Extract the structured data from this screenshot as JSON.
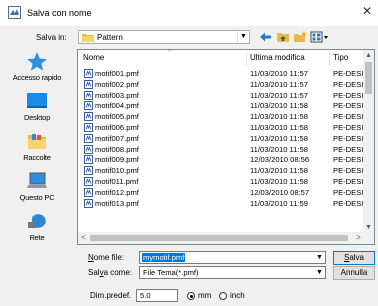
{
  "window": {
    "title": "Salva con nome",
    "close_glyph": "✕"
  },
  "lookin": {
    "label": "Salva in:",
    "value": "Pattern",
    "arrow": "▼"
  },
  "places": [
    {
      "label": "Accesso rapido",
      "icon": "star-icon"
    },
    {
      "label": "Desktop",
      "icon": "desktop-icon"
    },
    {
      "label": "Raccolte",
      "icon": "libraries-icon"
    },
    {
      "label": "Questo PC",
      "icon": "computer-icon"
    },
    {
      "label": "Rete",
      "icon": "network-icon"
    }
  ],
  "list": {
    "headers": {
      "name": "Nome",
      "date": "Ultima modifica",
      "type": "Tipo"
    },
    "rows": [
      {
        "name": "motif001.pmf",
        "date": "11/03/2010 11:57",
        "type": "PE-DESIGN"
      },
      {
        "name": "motif002.pmf",
        "date": "11/03/2010 11:57",
        "type": "PE-DESIGN"
      },
      {
        "name": "motif003.pmf",
        "date": "11/03/2010 11:57",
        "type": "PE-DESIGN"
      },
      {
        "name": "motif004.pmf",
        "date": "11/03/2010 11:58",
        "type": "PE-DESIGN"
      },
      {
        "name": "motif005.pmf",
        "date": "11/03/2010 11:58",
        "type": "PE-DESIGN"
      },
      {
        "name": "motif006.pmf",
        "date": "11/03/2010 11:58",
        "type": "PE-DESIGN"
      },
      {
        "name": "motif007.pmf",
        "date": "11/03/2010 11:58",
        "type": "PE-DESIGN"
      },
      {
        "name": "motif008.pmf",
        "date": "11/03/2010 11:58",
        "type": "PE-DESIGN"
      },
      {
        "name": "motif009.pmf",
        "date": "12/03/2010 08:56",
        "type": "PE-DESIGN"
      },
      {
        "name": "motif010.pmf",
        "date": "11/03/2010 11:58",
        "type": "PE-DESIGN"
      },
      {
        "name": "motif011.pmf",
        "date": "11/03/2010 11:58",
        "type": "PE-DESIGN"
      },
      {
        "name": "motif012.pmf",
        "date": "12/03/2010 08:57",
        "type": "PE-DESIGN"
      },
      {
        "name": "motif013.pmf",
        "date": "11/03/2010 11:59",
        "type": "PE-DESIGN"
      }
    ]
  },
  "filename": {
    "label_pre": "",
    "label_u": "N",
    "label_post": "ome file:",
    "value": "mymotif.pmf"
  },
  "filetype": {
    "label_pre": "Sal",
    "label_u": "v",
    "label_post": "a come:",
    "value": "File Tema(*.pmf)"
  },
  "buttons": {
    "save_u": "S",
    "save_rest": "alva",
    "cancel": "Annulla"
  },
  "dimpredef": {
    "label": "Dim.predef.",
    "value": "5.0",
    "unit_mm": "mm",
    "unit_inch": "inch",
    "selected": "mm"
  },
  "colors": {
    "accent": "#0078d7",
    "selection": "#0078d7"
  }
}
